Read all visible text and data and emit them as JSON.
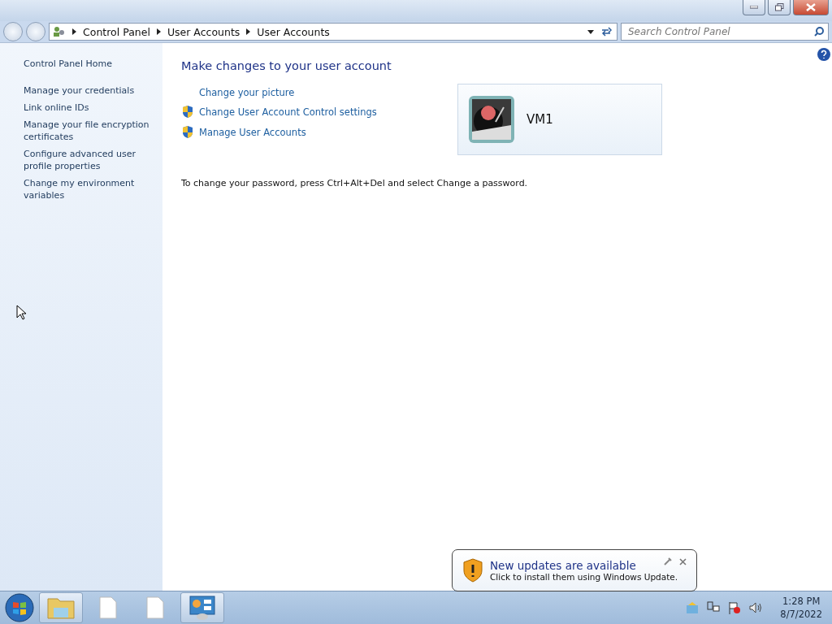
{
  "breadcrumb": [
    "Control Panel",
    "User Accounts",
    "User Accounts"
  ],
  "search": {
    "placeholder": "Search Control Panel"
  },
  "sidebar": {
    "home": "Control Panel Home",
    "items": [
      "Manage your credentials",
      "Link online IDs",
      "Manage your file encryption certificates",
      "Configure advanced user profile properties",
      "Change my environment variables"
    ]
  },
  "main": {
    "heading": "Make changes to your user account",
    "links": [
      {
        "label": "Change your picture",
        "shield": false
      },
      {
        "label": "Change User Account Control settings",
        "shield": true
      },
      {
        "label": "Manage User Accounts",
        "shield": true
      }
    ],
    "account": {
      "name": "VM1"
    },
    "note": "To change your password, press Ctrl+Alt+Del and select Change a password."
  },
  "notification": {
    "title": "New updates are available",
    "message": "Click to install them using Windows Update."
  },
  "taskbar": [
    {
      "kind": "explorer",
      "running": true
    },
    {
      "kind": "document",
      "running": false
    },
    {
      "kind": "document",
      "running": false
    },
    {
      "kind": "control-panel",
      "running": true
    }
  ],
  "clock": {
    "time": "1:28 PM",
    "date": "8/7/2022"
  }
}
